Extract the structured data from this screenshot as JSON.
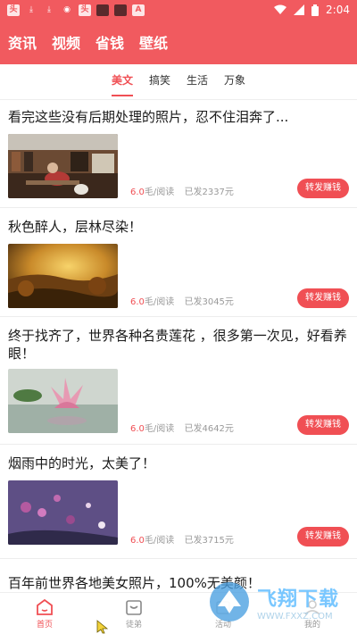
{
  "status_bar": {
    "time": "2:04",
    "icons": [
      "notification-icon",
      "download-icon",
      "download-icon",
      "eye-icon",
      "notification-icon",
      "app-icon",
      "app-icon",
      "a-icon",
      "wifi-icon",
      "signal-icon",
      "battery-icon"
    ]
  },
  "top_tabs": [
    "资讯",
    "视频",
    "省钱",
    "壁纸"
  ],
  "sub_tabs": {
    "items": [
      "美文",
      "搞笑",
      "生活",
      "万象"
    ],
    "active": 0
  },
  "articles": [
    {
      "title": "看完这些没有后期处理的照片，忍不住泪奔了...",
      "price": "6.0",
      "price_unit": "毛/阅读",
      "paid": "已发2337元",
      "button": "转发赚钱"
    },
    {
      "title": "秋色醉人，层林尽染！",
      "price": "6.0",
      "price_unit": "毛/阅读",
      "paid": "已发3045元",
      "button": "转发赚钱"
    },
    {
      "title": "终于找齐了，世界各种名贵莲花 ，很多第一次见，好看养眼！",
      "price": "6.0",
      "price_unit": "毛/阅读",
      "paid": "已发4642元",
      "button": "转发赚钱"
    },
    {
      "title": "烟雨中的时光，太美了！",
      "price": "6.0",
      "price_unit": "毛/阅读",
      "paid": "已发3715元",
      "button": "转发赚钱"
    },
    {
      "title": "百年前世界各地美女照片，100%无美颜！"
    }
  ],
  "bottom_nav": {
    "items": [
      "首页",
      "徒弟",
      "活动",
      "我的"
    ],
    "active": 0
  },
  "watermark": {
    "main": "飞翔下载",
    "sub": "WWW.FXXZ.COM"
  },
  "colors": {
    "brand": "#f15a5f",
    "accent": "#f04f54",
    "muted": "#999999"
  }
}
